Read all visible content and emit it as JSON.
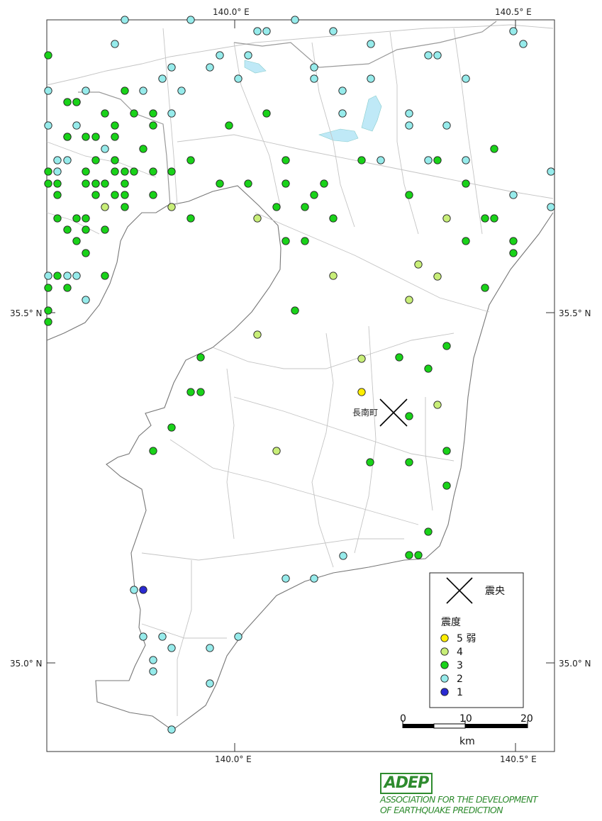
{
  "map": {
    "lon_labels": {
      "left": "140.0° E",
      "right": "140.5° E"
    },
    "lat_labels": {
      "upper": "35.5° N",
      "lower": "35.0° N"
    },
    "epicenter_label": "長南町"
  },
  "legend": {
    "epicenter": "震央",
    "intensity_title": "震度",
    "items": [
      {
        "label": "5 弱",
        "color": "#ffee00"
      },
      {
        "label": "4",
        "color": "#c8ee78"
      },
      {
        "label": "3",
        "color": "#19d219"
      },
      {
        "label": "2",
        "color": "#96ebeb"
      },
      {
        "label": "1",
        "color": "#2a2ad2"
      }
    ]
  },
  "scale_bar": {
    "ticks": [
      "0",
      "10",
      "20"
    ],
    "unit": "km"
  },
  "logo": {
    "abbr": "ADEP",
    "line1": "ASSOCIATION FOR THE DEVELOPMENT",
    "line2": "OF EARTHQUAKE PREDICTION"
  },
  "intensity_points": {
    "5-": [
      [
        510,
        553
      ]
    ],
    "4": [
      [
        148,
        292
      ],
      [
        242,
        292
      ],
      [
        363,
        308
      ],
      [
        630,
        308
      ],
      [
        590,
        373
      ],
      [
        617,
        390
      ],
      [
        470,
        389
      ],
      [
        577,
        423
      ],
      [
        363,
        472
      ],
      [
        510,
        506
      ],
      [
        617,
        571
      ],
      [
        390,
        636
      ]
    ],
    "3": [
      [
        68,
        78
      ],
      [
        176,
        128
      ],
      [
        95,
        144
      ],
      [
        108,
        144
      ],
      [
        148,
        160
      ],
      [
        189,
        160
      ],
      [
        216,
        160
      ],
      [
        376,
        160
      ],
      [
        162,
        177
      ],
      [
        216,
        177
      ],
      [
        323,
        177
      ],
      [
        95,
        193
      ],
      [
        121,
        193
      ],
      [
        135,
        193
      ],
      [
        162,
        193
      ],
      [
        202,
        210
      ],
      [
        697,
        210
      ],
      [
        135,
        226
      ],
      [
        162,
        226
      ],
      [
        269,
        226
      ],
      [
        403,
        226
      ],
      [
        510,
        226
      ],
      [
        617,
        226
      ],
      [
        68,
        242
      ],
      [
        121,
        242
      ],
      [
        162,
        242
      ],
      [
        176,
        242
      ],
      [
        189,
        242
      ],
      [
        216,
        242
      ],
      [
        242,
        242
      ],
      [
        68,
        259
      ],
      [
        81,
        259
      ],
      [
        121,
        259
      ],
      [
        135,
        259
      ],
      [
        148,
        259
      ],
      [
        176,
        259
      ],
      [
        310,
        259
      ],
      [
        350,
        259
      ],
      [
        403,
        259
      ],
      [
        457,
        259
      ],
      [
        81,
        275
      ],
      [
        135,
        275
      ],
      [
        162,
        275
      ],
      [
        176,
        275
      ],
      [
        216,
        275
      ],
      [
        443,
        275
      ],
      [
        577,
        275
      ],
      [
        657,
        259
      ],
      [
        176,
        292
      ],
      [
        390,
        292
      ],
      [
        430,
        292
      ],
      [
        81,
        308
      ],
      [
        108,
        308
      ],
      [
        121,
        308
      ],
      [
        269,
        308
      ],
      [
        470,
        308
      ],
      [
        684,
        308
      ],
      [
        697,
        308
      ],
      [
        95,
        324
      ],
      [
        121,
        324
      ],
      [
        148,
        324
      ],
      [
        657,
        340
      ],
      [
        724,
        340
      ],
      [
        403,
        340
      ],
      [
        430,
        340
      ],
      [
        108,
        340
      ],
      [
        121,
        357
      ],
      [
        724,
        357
      ],
      [
        81,
        389
      ],
      [
        148,
        389
      ],
      [
        68,
        406
      ],
      [
        95,
        406
      ],
      [
        684,
        406
      ],
      [
        416,
        438
      ],
      [
        68,
        438
      ],
      [
        68,
        454
      ],
      [
        630,
        488
      ],
      [
        283,
        504
      ],
      [
        563,
        504
      ],
      [
        604,
        520
      ],
      [
        269,
        553
      ],
      [
        283,
        553
      ],
      [
        577,
        587
      ],
      [
        242,
        603
      ],
      [
        216,
        636
      ],
      [
        630,
        636
      ],
      [
        522,
        652
      ],
      [
        577,
        652
      ],
      [
        630,
        685
      ],
      [
        604,
        750
      ],
      [
        577,
        783
      ],
      [
        590,
        783
      ]
    ],
    "2": [
      [
        176,
        28
      ],
      [
        269,
        28
      ],
      [
        363,
        44
      ],
      [
        376,
        44
      ],
      [
        416,
        28
      ],
      [
        470,
        44
      ],
      [
        724,
        44
      ],
      [
        162,
        62
      ],
      [
        523,
        62
      ],
      [
        738,
        62
      ],
      [
        310,
        78
      ],
      [
        350,
        78
      ],
      [
        604,
        78
      ],
      [
        617,
        78
      ],
      [
        242,
        95
      ],
      [
        296,
        95
      ],
      [
        443,
        95
      ],
      [
        229,
        111
      ],
      [
        336,
        111
      ],
      [
        443,
        111
      ],
      [
        523,
        111
      ],
      [
        657,
        111
      ],
      [
        68,
        128
      ],
      [
        121,
        128
      ],
      [
        202,
        128
      ],
      [
        256,
        128
      ],
      [
        483,
        128
      ],
      [
        108,
        144
      ],
      [
        242,
        160
      ],
      [
        483,
        160
      ],
      [
        577,
        160
      ],
      [
        68,
        177
      ],
      [
        108,
        177
      ],
      [
        577,
        177
      ],
      [
        630,
        177
      ],
      [
        95,
        193
      ],
      [
        148,
        210
      ],
      [
        81,
        226
      ],
      [
        95,
        226
      ],
      [
        537,
        226
      ],
      [
        604,
        226
      ],
      [
        81,
        242
      ],
      [
        657,
        226
      ],
      [
        777,
        242
      ],
      [
        135,
        259
      ],
      [
        724,
        275
      ],
      [
        777,
        292
      ],
      [
        68,
        389
      ],
      [
        95,
        389
      ],
      [
        108,
        389
      ],
      [
        121,
        423
      ],
      [
        484,
        784
      ],
      [
        403,
        816
      ],
      [
        443,
        816
      ],
      [
        189,
        832
      ],
      [
        202,
        898
      ],
      [
        229,
        898
      ],
      [
        336,
        898
      ],
      [
        242,
        914
      ],
      [
        296,
        914
      ],
      [
        216,
        931
      ],
      [
        216,
        947
      ],
      [
        296,
        964
      ],
      [
        242,
        1029
      ]
    ],
    "1": [
      [
        202,
        832
      ]
    ]
  }
}
